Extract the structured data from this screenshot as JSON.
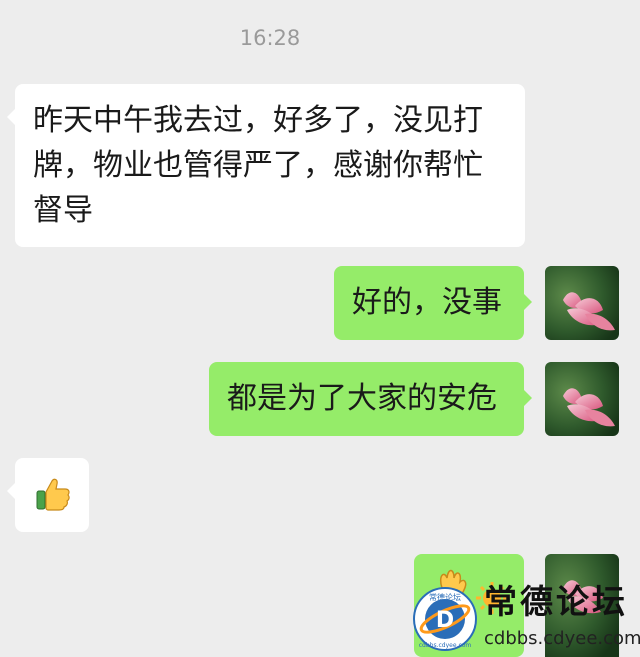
{
  "chat": {
    "timestamp": "16:28",
    "messages": [
      {
        "side": "left",
        "text": "昨天中午我去过，好多了，没见打牌，物业也管得严了，感谢你帮忙督导"
      },
      {
        "side": "right",
        "text": "好的，没事"
      },
      {
        "side": "right",
        "text": "都是为了大家的安危"
      },
      {
        "side": "left",
        "sticker": "thumbs-up-icon"
      },
      {
        "side": "right",
        "sticker": "wave-sun-emoji"
      }
    ]
  },
  "watermark": {
    "logo_letters": "常德论坛",
    "title": "常德论坛",
    "url": "cdbbs.cdyee.com",
    "ring_text": "cdbbs.cdyee.com"
  },
  "colors": {
    "background": "#ededed",
    "incoming_bubble": "#ffffff",
    "outgoing_bubble": "#95ec69",
    "timestamp": "#9a9a9a"
  }
}
